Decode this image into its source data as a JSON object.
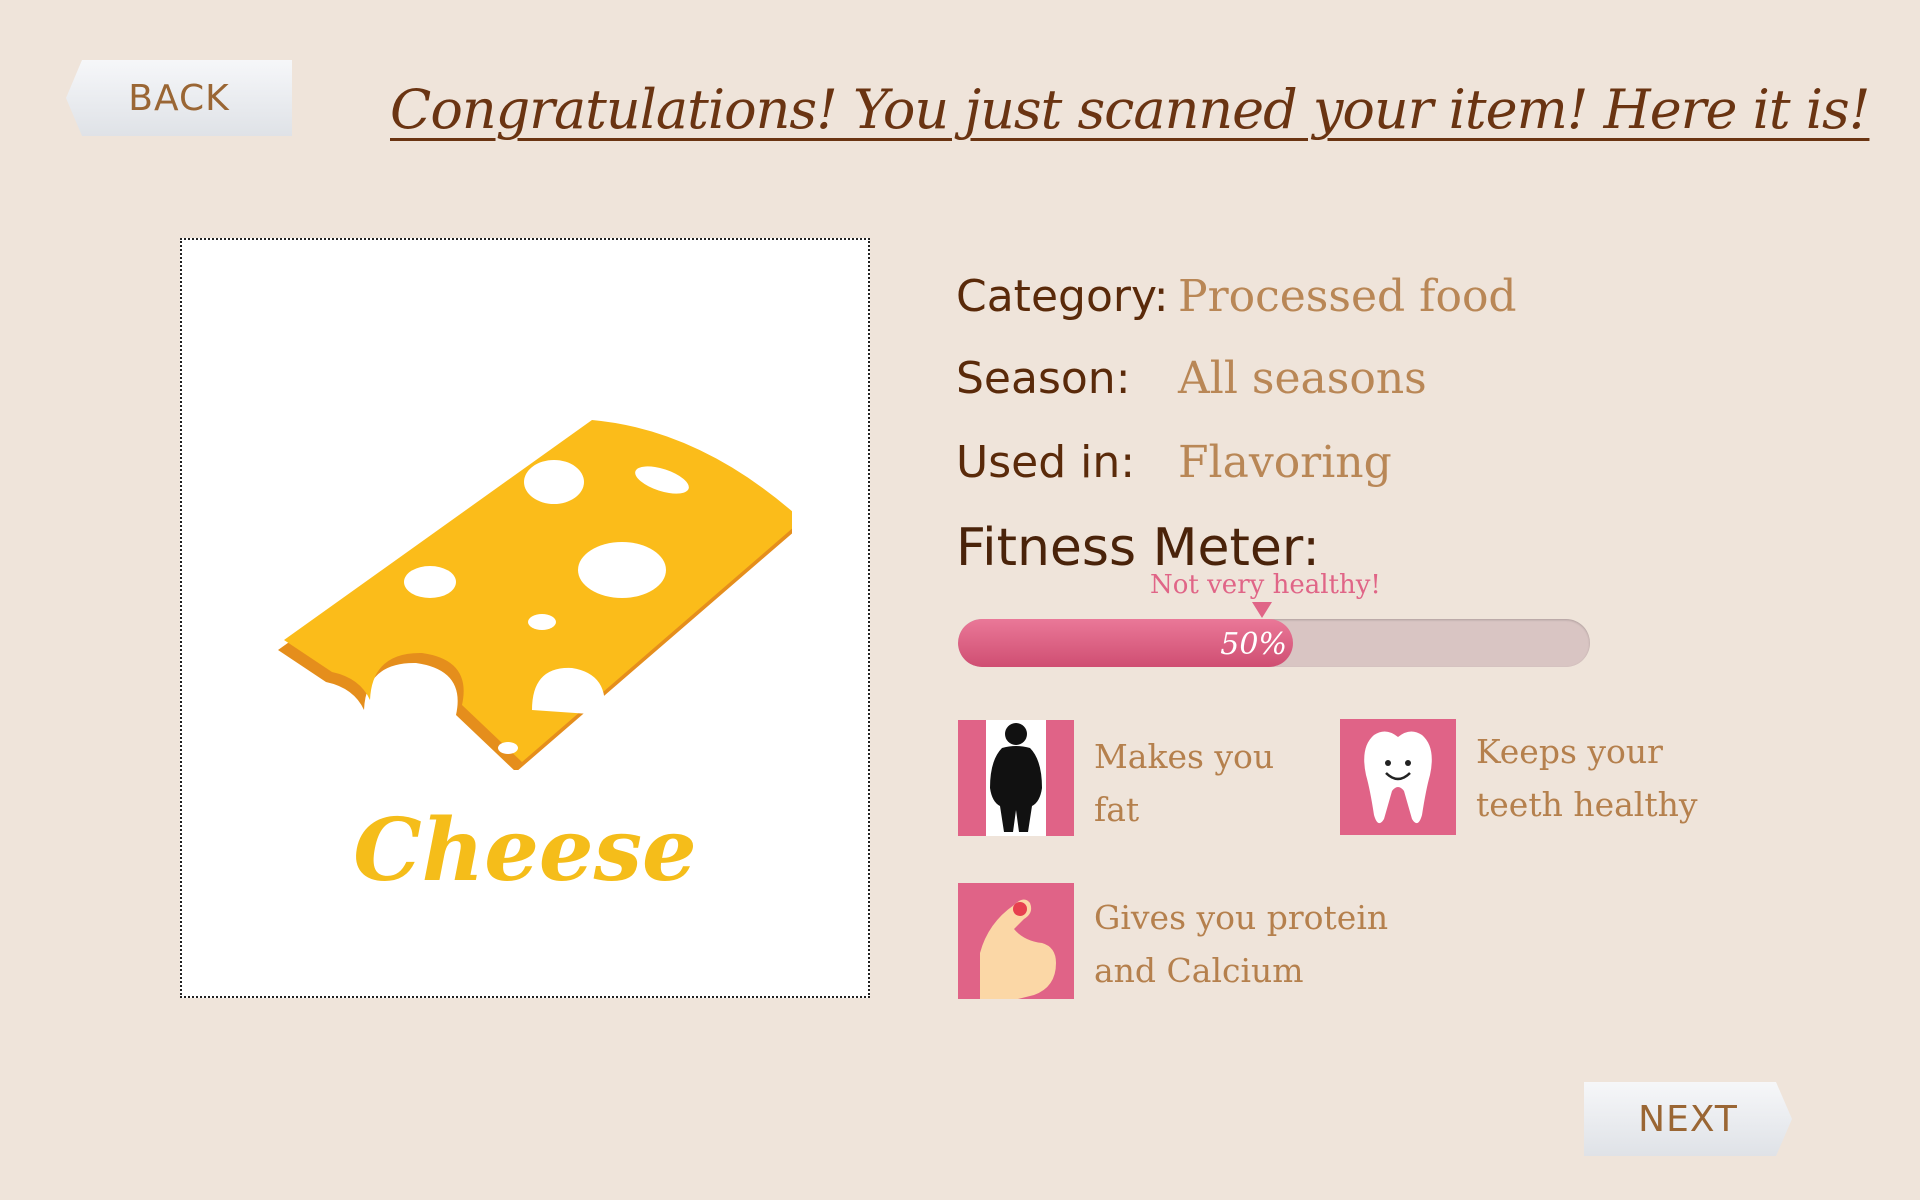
{
  "nav": {
    "back_label": "BACK",
    "next_label": "NEXT"
  },
  "headline": "Congratulations! You just scanned your item! Here it is!",
  "item": {
    "name": "Cheese",
    "image": "cheese-slice"
  },
  "details": [
    {
      "label": "Category:",
      "value": "Processed food"
    },
    {
      "label": "Season:",
      "value": "All seasons"
    },
    {
      "label": "Used in:",
      "value": "Flavoring"
    }
  ],
  "fitness": {
    "title": "Fitness Meter:",
    "note": "Not very healthy!",
    "percent_label": "50%",
    "level": 0.5
  },
  "benefits": [
    {
      "icon": "overweight-person-icon",
      "text": "Makes you fat"
    },
    {
      "icon": "smiling-tooth-icon",
      "text": "Keeps your teeth healthy"
    },
    {
      "icon": "flexed-arm-icon",
      "text": "Gives you protein and Calcium"
    }
  ],
  "colors": {
    "background": "#efe4da",
    "heading": "#6a3412",
    "accent_pink": "#e06387",
    "cheese_yellow": "#f5bd1a",
    "value_text": "#b98756"
  }
}
